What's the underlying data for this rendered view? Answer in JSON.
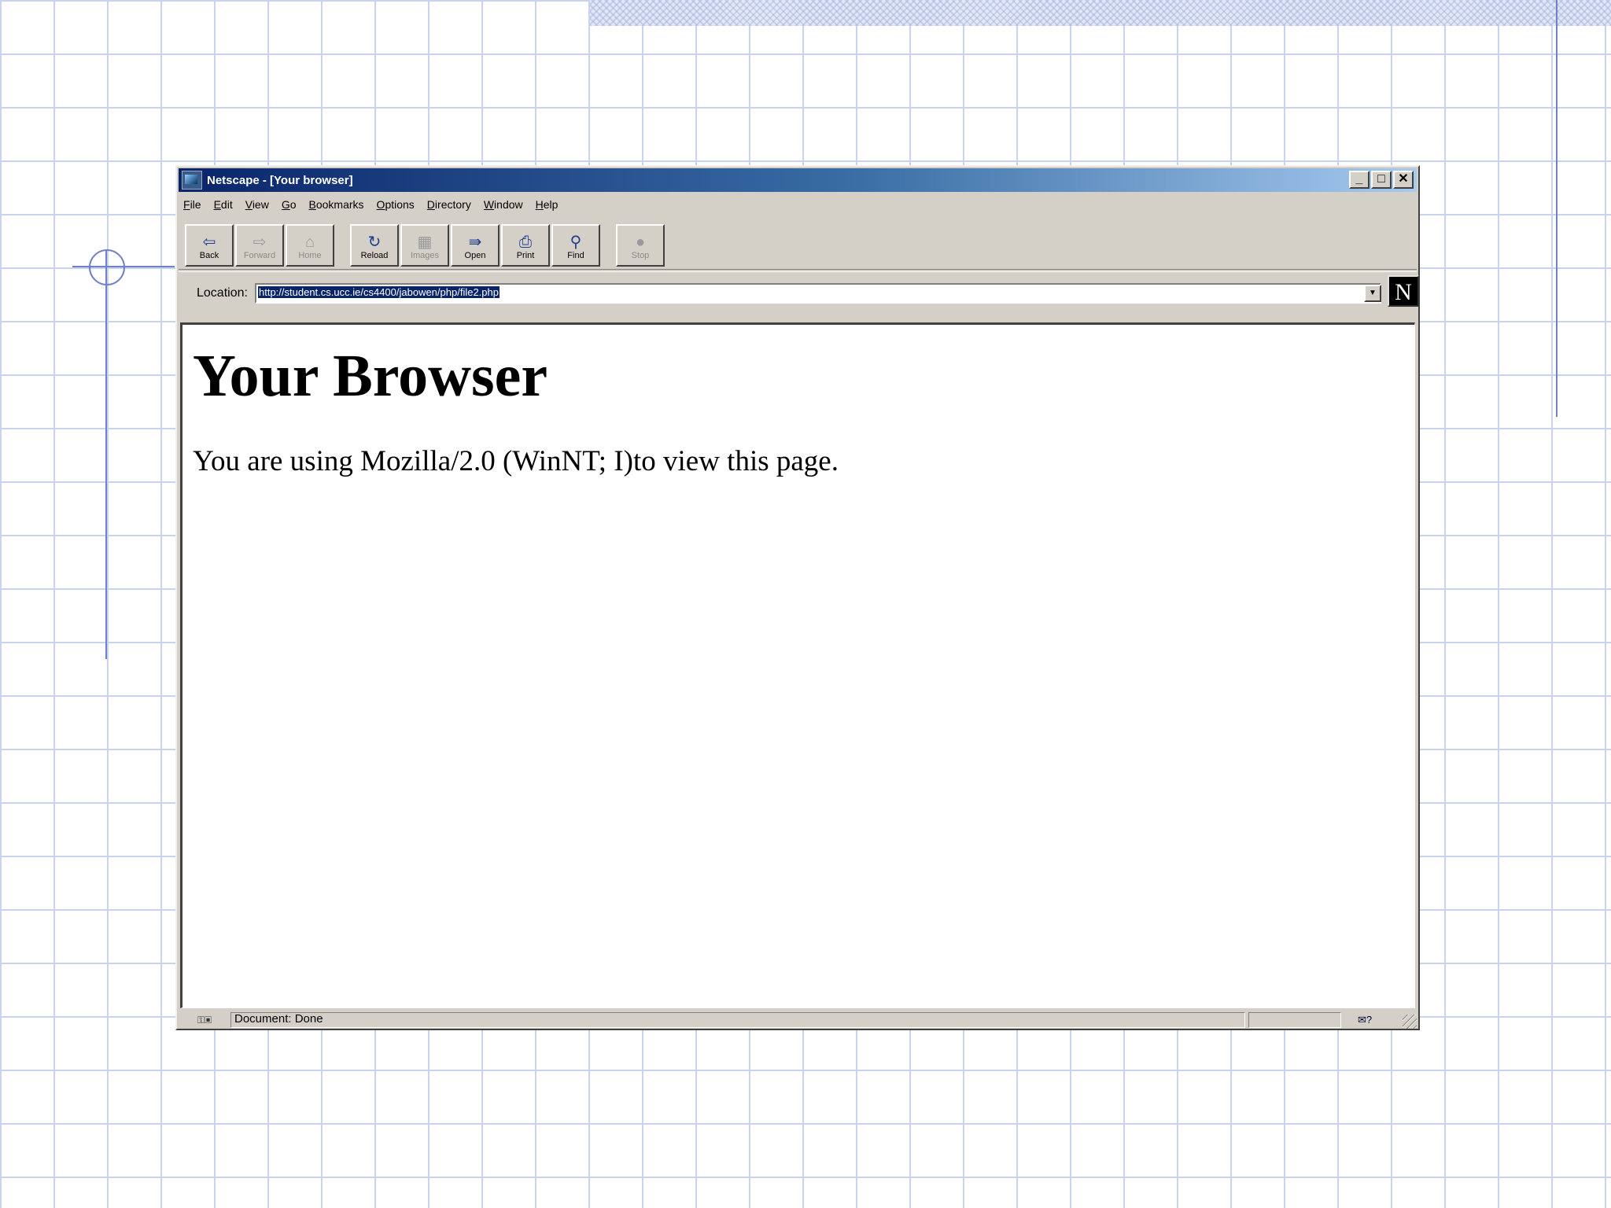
{
  "window": {
    "title": "Netscape - [Your browser]"
  },
  "menu": {
    "items": [
      "File",
      "Edit",
      "View",
      "Go",
      "Bookmarks",
      "Options",
      "Directory",
      "Window",
      "Help"
    ]
  },
  "toolbar": {
    "back": "Back",
    "forward": "Forward",
    "home": "Home",
    "reload": "Reload",
    "images": "Images",
    "open": "Open",
    "print": "Print",
    "find": "Find",
    "stop": "Stop"
  },
  "location": {
    "label": "Location:",
    "url": "http://student.cs.ucc.ie/cs4400/jabowen/php/file2.php"
  },
  "logo": {
    "letter": "N"
  },
  "page": {
    "heading": "Your Browser",
    "body": "You are using Mozilla/2.0 (WinNT; I)to view this page."
  },
  "status": {
    "text": "Document: Done"
  }
}
